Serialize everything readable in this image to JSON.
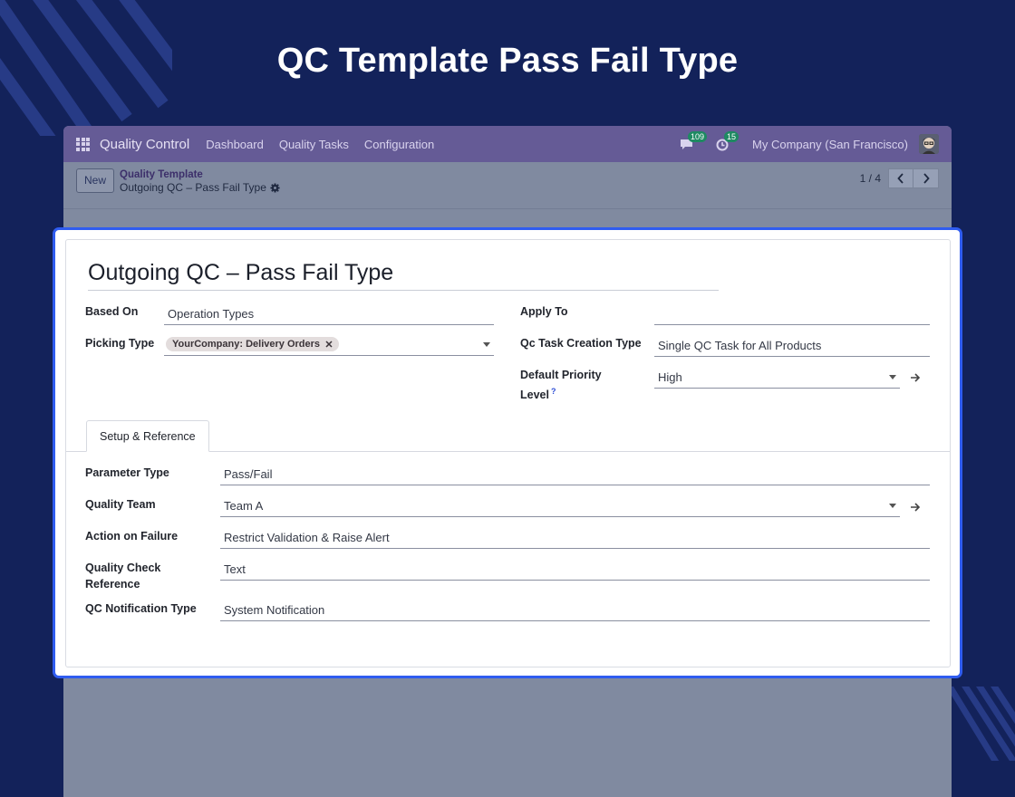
{
  "hero": {
    "title": "QC Template Pass Fail Type"
  },
  "navbar": {
    "app_name": "Quality Control",
    "menu": [
      "Dashboard",
      "Quality Tasks",
      "Configuration"
    ],
    "messages_count": "109",
    "activities_count": "15",
    "company": "My Company (San Francisco)"
  },
  "control": {
    "new_label": "New",
    "breadcrumb_parent": "Quality Template",
    "breadcrumb_current": "Outgoing QC – Pass Fail Type",
    "pager": "1 / 4"
  },
  "form": {
    "title": "Outgoing QC – Pass Fail Type",
    "based_on_label": "Based On",
    "based_on_value": "Operation Types",
    "picking_type_label": "Picking Type",
    "picking_type_tag": "YourCompany: Delivery Orders",
    "apply_to_label": "Apply To",
    "apply_to_value": "",
    "qc_task_creation_label": "Qc Task Creation Type",
    "qc_task_creation_value": "Single QC Task for All Products",
    "priority_label_1": "Default Priority",
    "priority_label_2": "Level",
    "priority_help": "?",
    "priority_value": "High",
    "tab_label": "Setup & Reference",
    "parameter_type_label": "Parameter Type",
    "parameter_type_value": "Pass/Fail",
    "quality_team_label": "Quality Team",
    "quality_team_value": "Team A",
    "action_failure_label": "Action on Failure",
    "action_failure_value": "Restrict Validation & Raise Alert",
    "qc_reference_label_1": "Quality Check",
    "qc_reference_label_2": "Reference",
    "qc_reference_value": "Text",
    "notification_label": "QC Notification Type",
    "notification_value": "System Notification"
  },
  "colors": {
    "background": "#13225a",
    "navbar": "#655b96",
    "highlight_border": "#2f5cf0",
    "badge": "#1e8a62"
  }
}
